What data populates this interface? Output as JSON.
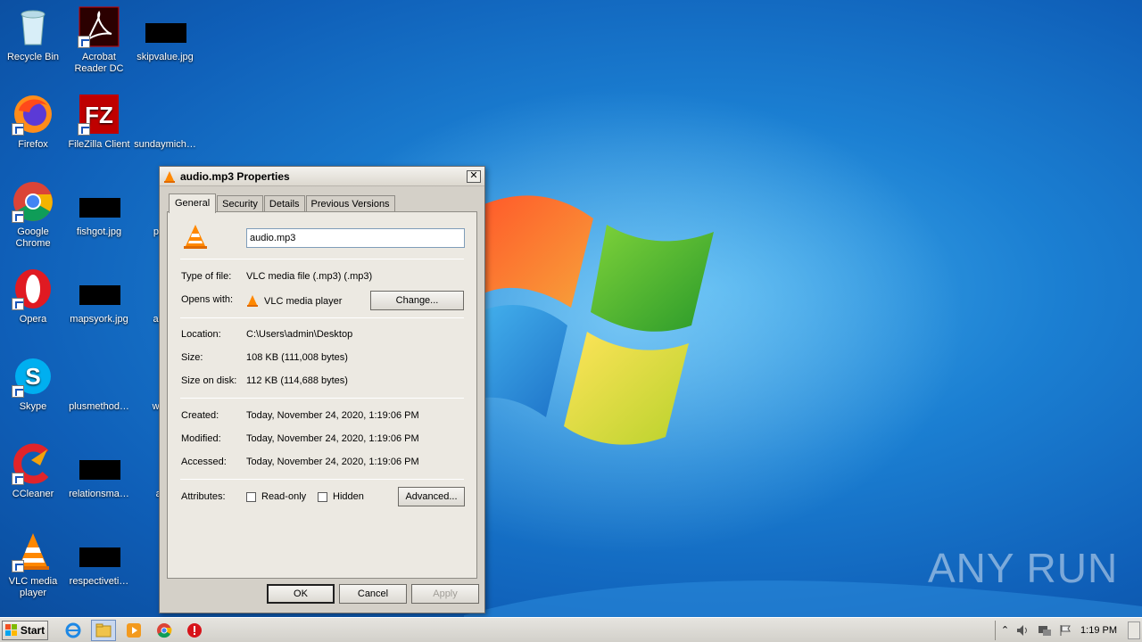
{
  "desktop": {
    "icons": [
      {
        "label": "Recycle Bin",
        "icon": "recycle-bin-icon"
      },
      {
        "label": "Acrobat Reader DC",
        "icon": "acrobat-icon"
      },
      {
        "label": "skipvalue.jpg",
        "icon": "image-file-icon"
      },
      {
        "label": "Firefox",
        "icon": "firefox-icon"
      },
      {
        "label": "FileZilla Client",
        "icon": "filezilla-icon"
      },
      {
        "label": "sundaymich…",
        "icon": "file-icon"
      },
      {
        "label": "Google Chrome",
        "icon": "chrome-icon"
      },
      {
        "label": "fishgot.jpg",
        "icon": "image-file-icon"
      },
      {
        "label": "paulc",
        "icon": "word-file-icon"
      },
      {
        "label": "Opera",
        "icon": "opera-icon"
      },
      {
        "label": "mapsyork.jpg",
        "icon": "image-file-icon"
      },
      {
        "label": "actho",
        "icon": "word-file-icon"
      },
      {
        "label": "Skype",
        "icon": "skype-icon"
      },
      {
        "label": "plusmethod…",
        "icon": "file-icon"
      },
      {
        "label": "whole",
        "icon": "word-file-icon"
      },
      {
        "label": "CCleaner",
        "icon": "ccleaner-icon"
      },
      {
        "label": "relationsma…",
        "icon": "image-file-icon"
      },
      {
        "label": "audi",
        "icon": "vlc-icon"
      },
      {
        "label": "VLC media player",
        "icon": "vlc-icon"
      },
      {
        "label": "respectiveti…",
        "icon": "image-file-icon"
      }
    ]
  },
  "dialog": {
    "title": "audio.mp3 Properties",
    "close_glyph": "✕",
    "tabs": [
      "General",
      "Security",
      "Details",
      "Previous Versions"
    ],
    "filename": "audio.mp3",
    "type_label": "Type of file:",
    "type_value": "VLC media file (.mp3) (.mp3)",
    "opens_label": "Opens with:",
    "opens_value": "VLC media player",
    "change_button": "Change...",
    "location_label": "Location:",
    "location_value": "C:\\Users\\admin\\Desktop",
    "size_label": "Size:",
    "size_value": "108 KB (111,008 bytes)",
    "size_disk_label": "Size on disk:",
    "size_disk_value": "112 KB (114,688 bytes)",
    "created_label": "Created:",
    "created_value": "Today, November 24, 2020, 1:19:06 PM",
    "modified_label": "Modified:",
    "modified_value": "Today, November 24, 2020, 1:19:06 PM",
    "accessed_label": "Accessed:",
    "accessed_value": "Today, November 24, 2020, 1:19:06 PM",
    "attributes_label": "Attributes:",
    "readonly_label": "Read-only",
    "hidden_label": "Hidden",
    "readonly_checked": false,
    "hidden_checked": false,
    "advanced_button": "Advanced...",
    "ok_button": "OK",
    "cancel_button": "Cancel",
    "apply_button": "Apply"
  },
  "taskbar": {
    "start_label": "Start",
    "clock": "1:19 PM",
    "pinned": [
      "ie-icon",
      "explorer-icon",
      "media-player-icon",
      "chrome-icon",
      "stop-icon"
    ]
  },
  "watermark": "ANY RUN"
}
